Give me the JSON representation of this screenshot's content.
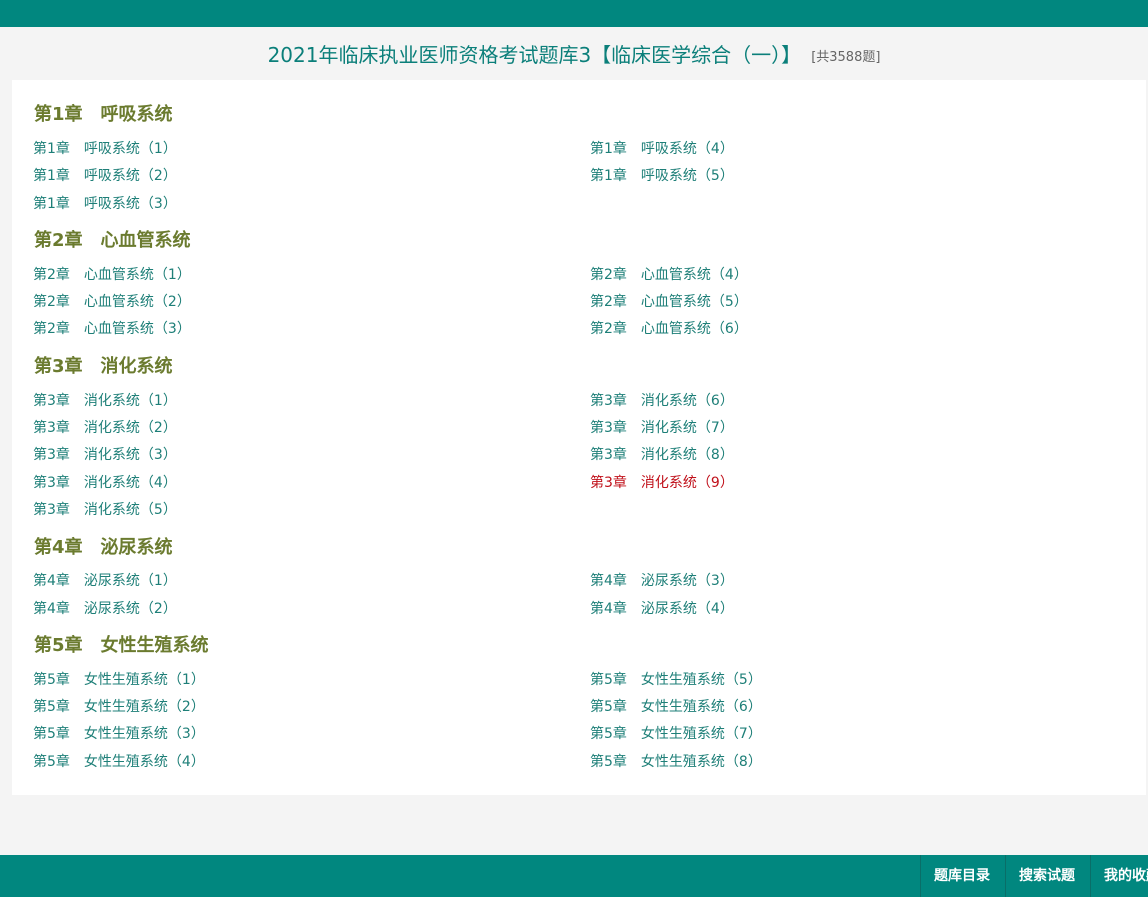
{
  "header": {
    "title": "2021年临床执业医师资格考试题库3【临床医学综合（一）】",
    "count": "[共3588题]"
  },
  "chapters": [
    {
      "title": "第1章　呼吸系统",
      "items": [
        "第1章　呼吸系统（1）",
        "第1章　呼吸系统（2）",
        "第1章　呼吸系统（3）",
        "第1章　呼吸系统（4）",
        "第1章　呼吸系统（5）"
      ]
    },
    {
      "title": "第2章　心血管系统",
      "items": [
        "第2章　心血管系统（1）",
        "第2章　心血管系统（2）",
        "第2章　心血管系统（3）",
        "第2章　心血管系统（4）",
        "第2章　心血管系统（5）",
        "第2章　心血管系统（6）"
      ]
    },
    {
      "title": "第3章　消化系统",
      "items": [
        "第3章　消化系统（1）",
        "第3章　消化系统（2）",
        "第3章　消化系统（3）",
        "第3章　消化系统（4）",
        "第3章　消化系统（5）",
        "第3章　消化系统（6）",
        "第3章　消化系统（7）",
        "第3章　消化系统（8）",
        "第3章　消化系统（9）"
      ]
    },
    {
      "title": "第4章　泌尿系统",
      "items": [
        "第4章　泌尿系统（1）",
        "第4章　泌尿系统（2）",
        "第4章　泌尿系统（3）",
        "第4章　泌尿系统（4）"
      ]
    },
    {
      "title": "第5章　女性生殖系统",
      "items": [
        "第5章　女性生殖系统（1）",
        "第5章　女性生殖系统（2）",
        "第5章　女性生殖系统（3）",
        "第5章　女性生殖系统（4）",
        "第5章　女性生殖系统（5）",
        "第5章　女性生殖系统（6）",
        "第5章　女性生殖系统（7）",
        "第5章　女性生殖系统（8）"
      ]
    }
  ],
  "footer": {
    "catalog": "题库目录",
    "search": "搜索试题",
    "favorites": "我的收藏"
  },
  "colors": {
    "brand": "#01877f",
    "link": "#1e7f78",
    "active_link": "#c0101a",
    "chapter_heading": "#6b7b2f"
  }
}
